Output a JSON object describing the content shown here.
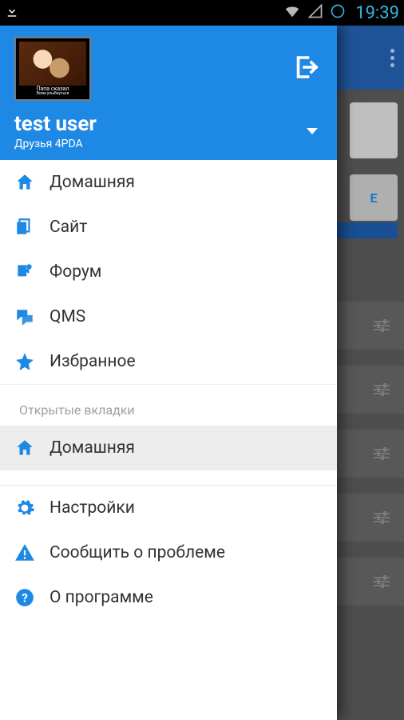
{
  "status": {
    "time": "19:39"
  },
  "drawer": {
    "avatar_caption_top": "Папа сказал",
    "avatar_caption_bottom": "Всем улыбнуться",
    "user_name": "test user",
    "user_sub": "Друзья 4PDA",
    "nav": [
      {
        "icon": "home",
        "label": "Домашняя"
      },
      {
        "icon": "site",
        "label": "Сайт"
      },
      {
        "icon": "forum",
        "label": "Форум"
      },
      {
        "icon": "qms",
        "label": "QMS"
      },
      {
        "icon": "star",
        "label": "Избранное"
      }
    ],
    "open_tabs_label": "Открытые вкладки",
    "open_tabs": [
      {
        "icon": "home",
        "label": "Домашняя",
        "selected": true
      }
    ],
    "footer": [
      {
        "icon": "gear",
        "label": "Настройки"
      },
      {
        "icon": "warn",
        "label": "Сообщить о проблеме"
      },
      {
        "icon": "help",
        "label": "О программе"
      }
    ]
  },
  "background": {
    "card2_letter": "E"
  }
}
